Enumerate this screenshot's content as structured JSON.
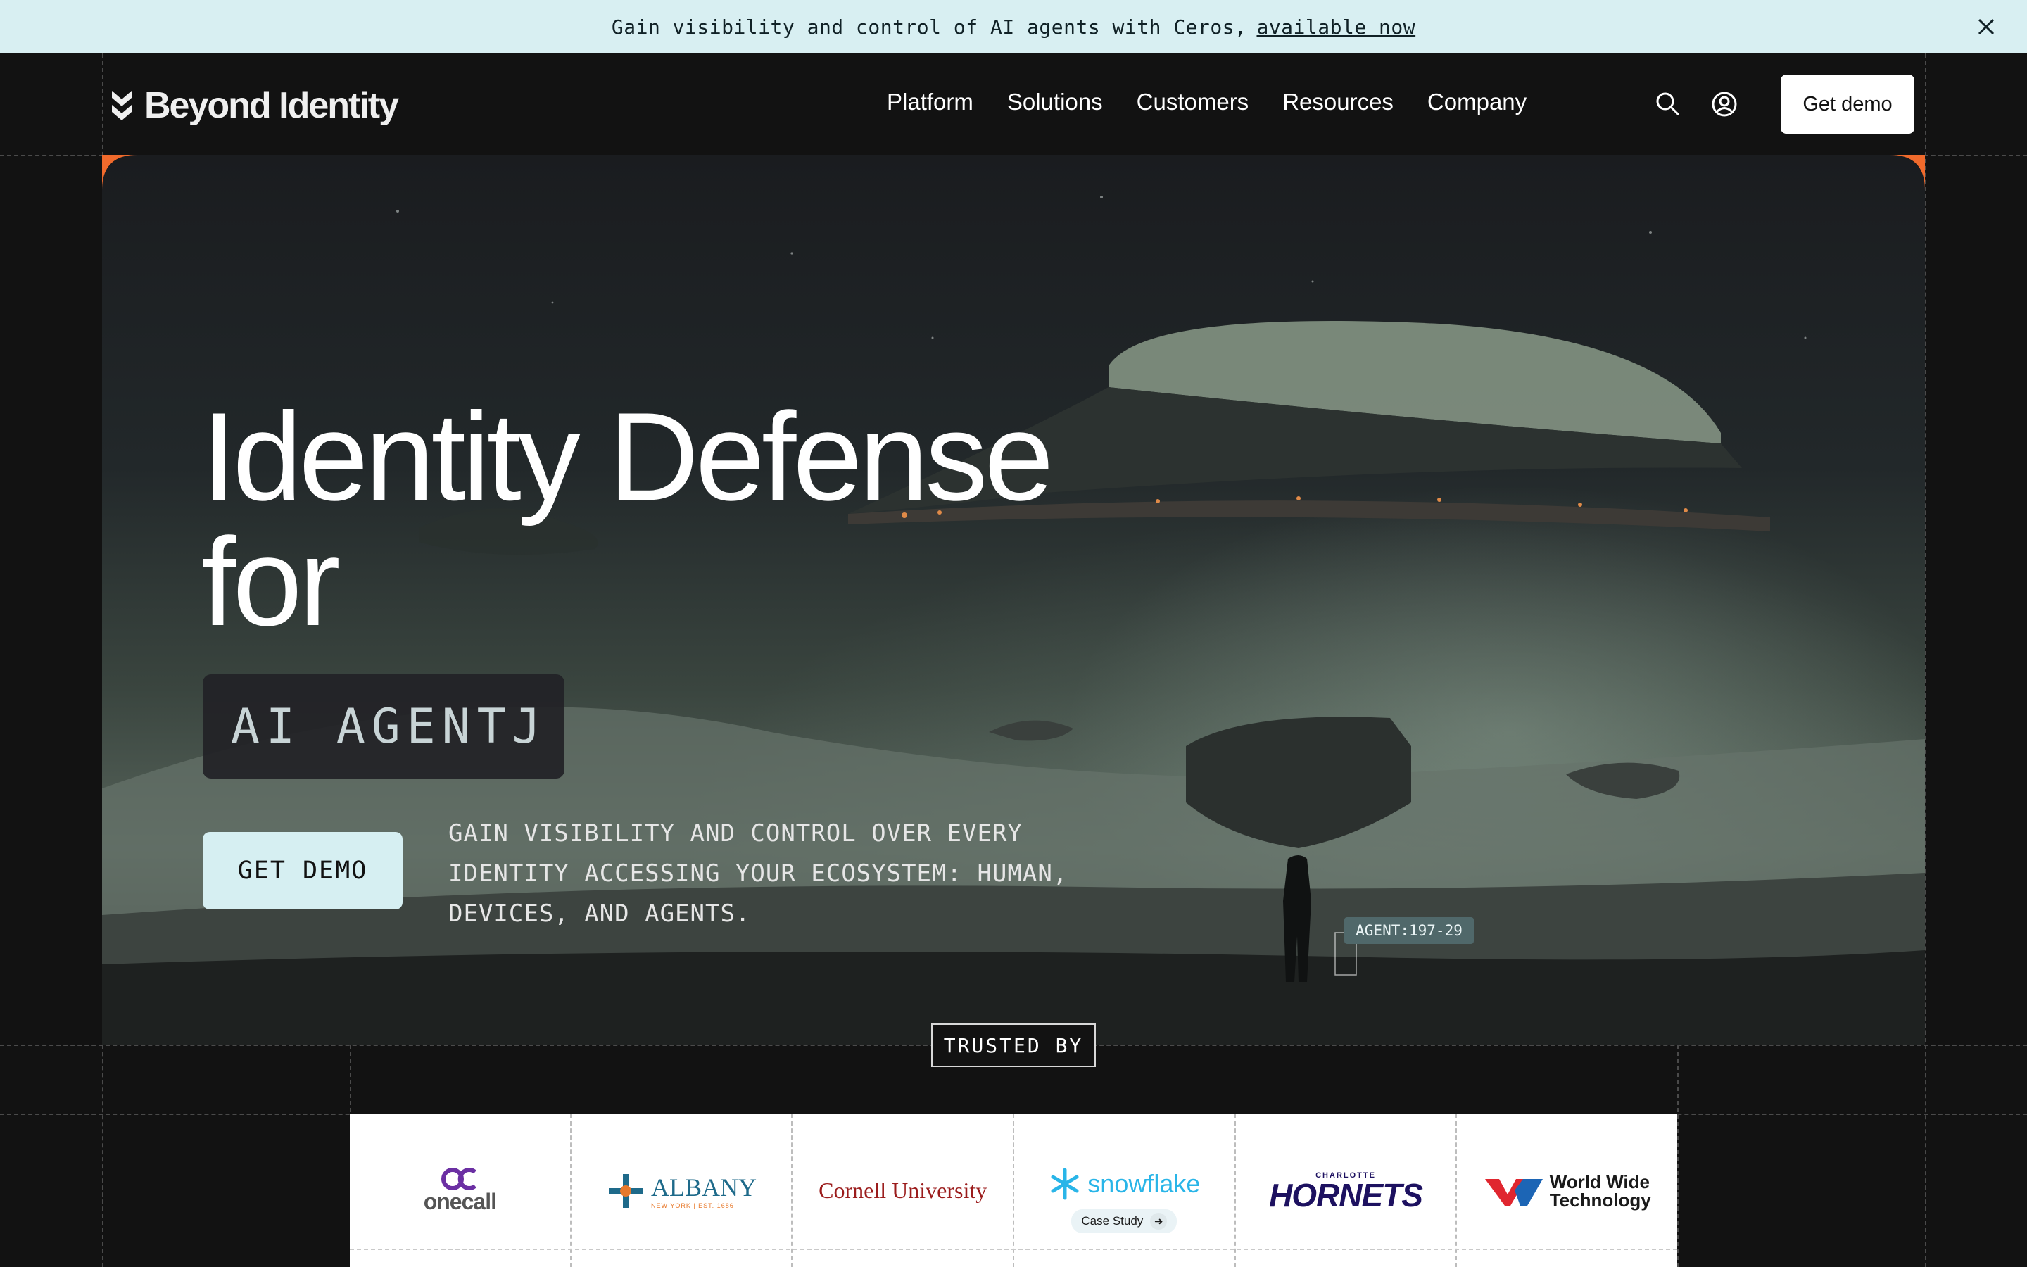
{
  "announcement": {
    "text": "Gain visibility and control of AI agents with Ceros,",
    "link": "available now"
  },
  "header": {
    "brand": "Beyond Identity",
    "nav": [
      "Platform",
      "Solutions",
      "Customers",
      "Resources",
      "Company"
    ],
    "cta": "Get demo"
  },
  "hero": {
    "headline_line1": "Identity Defense",
    "headline_line2": "for",
    "typing": "AI AGENTJ",
    "cta": "GET DEMO",
    "subtext": "GAIN VISIBILITY AND CONTROL OVER EVERY IDENTITY ACCESSING YOUR ECOSYSTEM: HUMAN, DEVICES, AND AGENTS.",
    "agent_tag": "AGENT:197-29"
  },
  "trusted": {
    "label": "TRUSTED BY",
    "logos": [
      {
        "name": "onecall",
        "text": "onecall"
      },
      {
        "name": "albany",
        "text": "ALBANY",
        "subtext": "NEW YORK | EST. 1686"
      },
      {
        "name": "cornell",
        "text": "Cornell University"
      },
      {
        "name": "snowflake",
        "text": "snowflake",
        "badge": "Case Study"
      },
      {
        "name": "hornets",
        "text": "HORNETS",
        "subtext": "CHARLOTTE"
      },
      {
        "name": "wwt",
        "text_line1": "World Wide",
        "text_line2": "Technology"
      }
    ]
  },
  "colors": {
    "accent": "#d8eff2",
    "corner": "#f06a2c",
    "background": "#121212"
  }
}
